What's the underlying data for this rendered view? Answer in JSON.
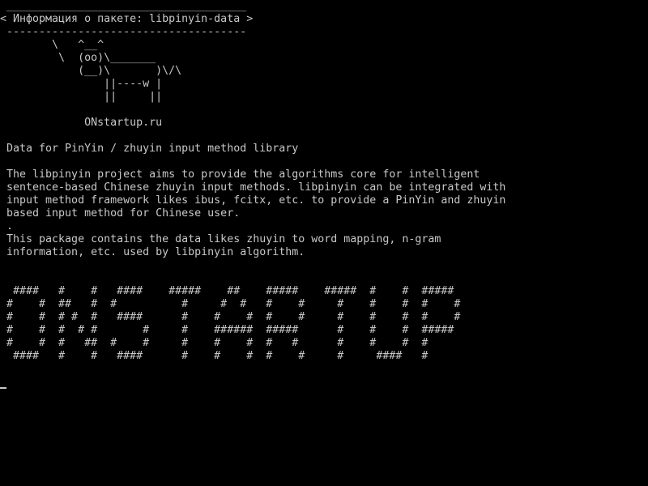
{
  "terminal": {
    "colors": {
      "background": "#000000",
      "foreground": "#c8c8c8"
    },
    "lines": [
      " _____________________________________",
      "< Информация о пакете: libpinyin-data >",
      " -------------------------------------",
      "        \\   ^__^",
      "         \\  (oo)\\_______",
      "            (__)\\       )\\/\\",
      "                ||----w |",
      "                ||     ||",
      "",
      "             ONstartup.ru",
      "",
      " Data for PinYin / zhuyin input method library",
      "",
      " The libpinyin project aims to provide the algorithms core for intelligent",
      " sentence-based Chinese zhuyin input methods. libpinyin can be integrated with",
      " input method framework likes ibus, fcitx, etc. to provide a PinYin and zhuyin",
      " based input method for Chinese user.",
      " .",
      " This package contains the data likes zhuyin to word mapping, n-gram",
      " information, etc. used by libpinyin algorithm.",
      "",
      "",
      "  ####   #    #   ####    #####    ##    #####    #####  #    #  #####",
      " #    #  ##   #  #          #     #  #   #    #     #    #    #  #    #",
      " #    #  # #  #   ####      #    #    #  #    #     #    #    #  #    #",
      " #    #  #  # #       #     #    ######  #####      #    #    #  #####",
      " #    #  #   ##  #    #     #    #    #  #   #      #    #    #  #",
      "  ####   #    #   ####      #    #    #  #    #     #     ####   #",
      "",
      ""
    ]
  }
}
